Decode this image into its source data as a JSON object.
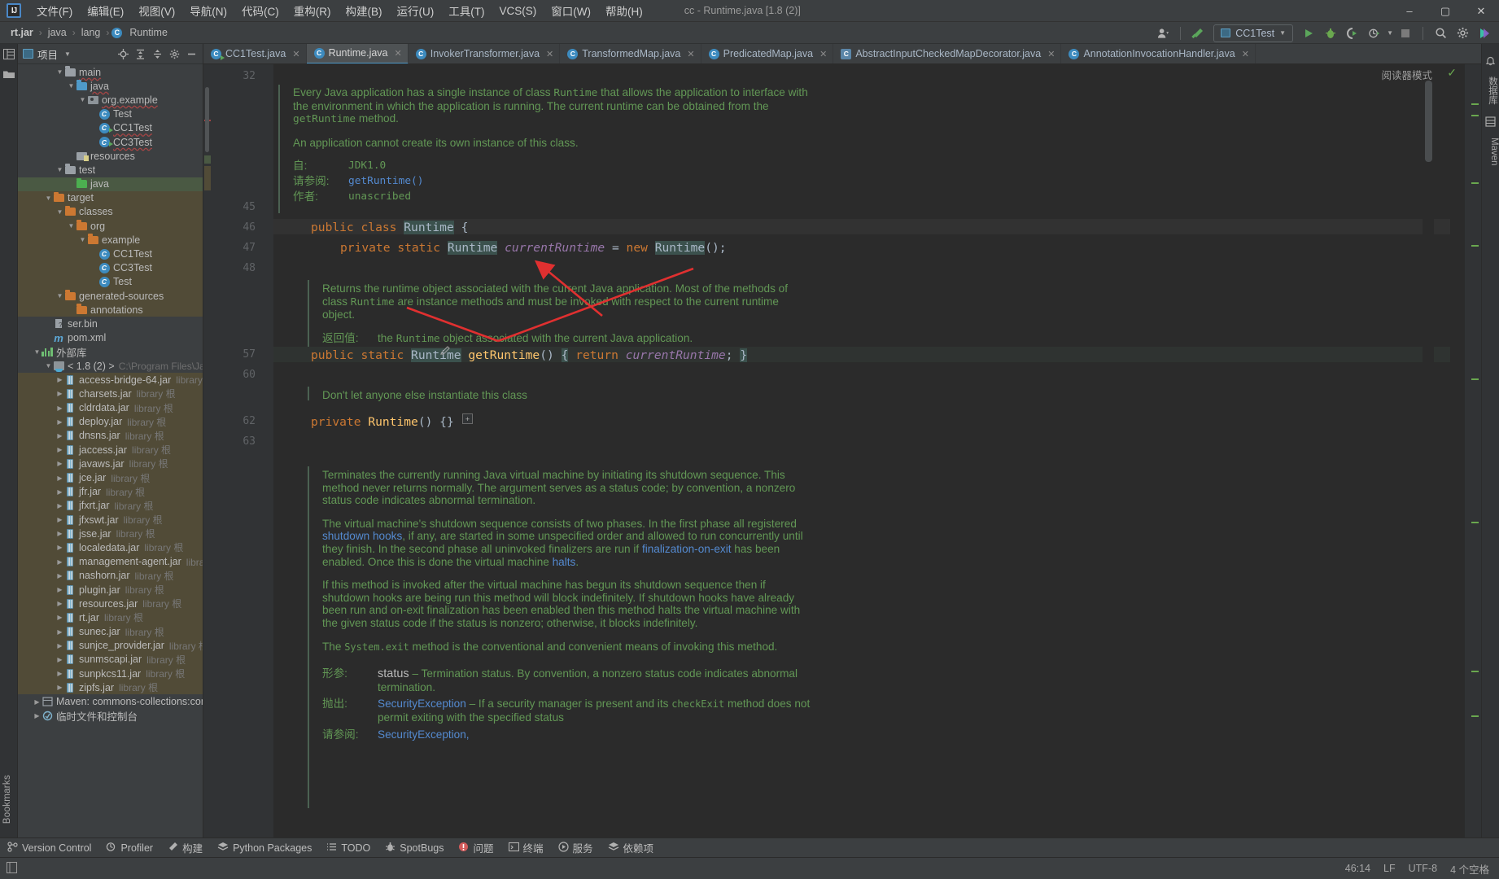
{
  "window": {
    "title": "cc - Runtime.java [1.8 (2)]",
    "minimize": "–",
    "maximize": "▢",
    "close": "✕"
  },
  "menu": {
    "logo": "IJ",
    "items": [
      "文件(F)",
      "编辑(E)",
      "视图(V)",
      "导航(N)",
      "代码(C)",
      "重构(R)",
      "构建(B)",
      "运行(U)",
      "工具(T)",
      "VCS(S)",
      "窗口(W)",
      "帮助(H)"
    ]
  },
  "breadcrumb": {
    "jar": "rt.jar",
    "pkg1": "java",
    "pkg2": "lang",
    "cls": "Runtime",
    "cls_icon_letter": "C",
    "sep": "›"
  },
  "nav_toolbar": {
    "run_config": "CC1Test",
    "icons": [
      "user-icon",
      "hammer-icon",
      "run-icon",
      "debug-icon",
      "run-coverage-icon",
      "profiler-icon",
      "stop-icon",
      "search-icon",
      "settings-icon",
      "ai-icon"
    ]
  },
  "project_panel": {
    "title": "项目",
    "header_icons": [
      "locate-icon",
      "expand-all-icon",
      "collapse-all-icon",
      "settings-icon",
      "hide-icon"
    ],
    "tree": [
      {
        "indent": 3,
        "arrow": "v",
        "icon": "folder-gray",
        "name": "main",
        "meta": "",
        "wavy": true,
        "hl": "none"
      },
      {
        "indent": 4,
        "arrow": "v",
        "icon": "folder-blue",
        "name": "java",
        "meta": "",
        "wavy": true,
        "hl": "none"
      },
      {
        "indent": 5,
        "arrow": "v",
        "icon": "package",
        "name": "org.example",
        "meta": "",
        "wavy": true,
        "hl": "none"
      },
      {
        "indent": 6,
        "arrow": "",
        "icon": "class",
        "name": "Test",
        "meta": "",
        "wavy": false,
        "hl": "none"
      },
      {
        "indent": 6,
        "arrow": "",
        "icon": "class-run",
        "name": "CC1Test",
        "meta": "",
        "wavy": true,
        "hl": "none"
      },
      {
        "indent": 6,
        "arrow": "",
        "icon": "class-run",
        "name": "CC3Test",
        "meta": "",
        "wavy": true,
        "hl": "none"
      },
      {
        "indent": 4,
        "arrow": "",
        "icon": "folder-res",
        "name": "resources",
        "meta": "",
        "wavy": false,
        "hl": "none"
      },
      {
        "indent": 3,
        "arrow": "v",
        "icon": "folder-gray",
        "name": "test",
        "meta": "",
        "wavy": false,
        "hl": "none"
      },
      {
        "indent": 4,
        "arrow": "",
        "icon": "folder-green",
        "name": "java",
        "meta": "",
        "wavy": false,
        "hl": "green"
      },
      {
        "indent": 2,
        "arrow": "v",
        "icon": "folder-orange",
        "name": "target",
        "meta": "",
        "wavy": false,
        "hl": "target"
      },
      {
        "indent": 3,
        "arrow": "v",
        "icon": "folder-orange",
        "name": "classes",
        "meta": "",
        "wavy": false,
        "hl": "target"
      },
      {
        "indent": 4,
        "arrow": "v",
        "icon": "folder-orange",
        "name": "org",
        "meta": "",
        "wavy": false,
        "hl": "target"
      },
      {
        "indent": 5,
        "arrow": "v",
        "icon": "folder-orange",
        "name": "example",
        "meta": "",
        "wavy": false,
        "hl": "target"
      },
      {
        "indent": 6,
        "arrow": "",
        "icon": "class",
        "name": "CC1Test",
        "meta": "",
        "wavy": false,
        "hl": "target"
      },
      {
        "indent": 6,
        "arrow": "",
        "icon": "class",
        "name": "CC3Test",
        "meta": "",
        "wavy": false,
        "hl": "target"
      },
      {
        "indent": 6,
        "arrow": "",
        "icon": "class",
        "name": "Test",
        "meta": "",
        "wavy": false,
        "hl": "target"
      },
      {
        "indent": 3,
        "arrow": "v",
        "icon": "folder-orange",
        "name": "generated-sources",
        "meta": "",
        "wavy": false,
        "hl": "target"
      },
      {
        "indent": 4,
        "arrow": "",
        "icon": "folder-orange",
        "name": "annotations",
        "meta": "",
        "wavy": false,
        "hl": "target"
      },
      {
        "indent": 2,
        "arrow": "",
        "icon": "bin",
        "name": "ser.bin",
        "meta": "",
        "wavy": false,
        "hl": "none"
      },
      {
        "indent": 2,
        "arrow": "",
        "icon": "maven",
        "name": "pom.xml",
        "meta": "",
        "wavy": false,
        "hl": "none"
      },
      {
        "indent": 1,
        "arrow": "v",
        "icon": "library",
        "name": "外部库",
        "meta": "",
        "wavy": false,
        "hl": "none"
      },
      {
        "indent": 2,
        "arrow": "v",
        "icon": "sdk",
        "name": "< 1.8 (2) >",
        "meta": "",
        "path": "C:\\Program Files\\Java\\jdk",
        "wavy": false,
        "hl": "none"
      },
      {
        "indent": 3,
        "arrow": ">",
        "icon": "jar",
        "name": "access-bridge-64.jar",
        "meta": "library 根",
        "wavy": false,
        "hl": "jar"
      },
      {
        "indent": 3,
        "arrow": ">",
        "icon": "jar",
        "name": "charsets.jar",
        "meta": "library 根",
        "wavy": false,
        "hl": "jar"
      },
      {
        "indent": 3,
        "arrow": ">",
        "icon": "jar",
        "name": "cldrdata.jar",
        "meta": "library 根",
        "wavy": false,
        "hl": "jar"
      },
      {
        "indent": 3,
        "arrow": ">",
        "icon": "jar",
        "name": "deploy.jar",
        "meta": "library 根",
        "wavy": false,
        "hl": "jar"
      },
      {
        "indent": 3,
        "arrow": ">",
        "icon": "jar",
        "name": "dnsns.jar",
        "meta": "library 根",
        "wavy": false,
        "hl": "jar"
      },
      {
        "indent": 3,
        "arrow": ">",
        "icon": "jar",
        "name": "jaccess.jar",
        "meta": "library 根",
        "wavy": false,
        "hl": "jar"
      },
      {
        "indent": 3,
        "arrow": ">",
        "icon": "jar",
        "name": "javaws.jar",
        "meta": "library 根",
        "wavy": false,
        "hl": "jar"
      },
      {
        "indent": 3,
        "arrow": ">",
        "icon": "jar",
        "name": "jce.jar",
        "meta": "library 根",
        "wavy": false,
        "hl": "jar"
      },
      {
        "indent": 3,
        "arrow": ">",
        "icon": "jar",
        "name": "jfr.jar",
        "meta": "library 根",
        "wavy": false,
        "hl": "jar"
      },
      {
        "indent": 3,
        "arrow": ">",
        "icon": "jar",
        "name": "jfxrt.jar",
        "meta": "library 根",
        "wavy": false,
        "hl": "jar"
      },
      {
        "indent": 3,
        "arrow": ">",
        "icon": "jar",
        "name": "jfxswt.jar",
        "meta": "library 根",
        "wavy": false,
        "hl": "jar"
      },
      {
        "indent": 3,
        "arrow": ">",
        "icon": "jar",
        "name": "jsse.jar",
        "meta": "library 根",
        "wavy": false,
        "hl": "jar"
      },
      {
        "indent": 3,
        "arrow": ">",
        "icon": "jar",
        "name": "localedata.jar",
        "meta": "library 根",
        "wavy": false,
        "hl": "jar"
      },
      {
        "indent": 3,
        "arrow": ">",
        "icon": "jar",
        "name": "management-agent.jar",
        "meta": "library 根",
        "wavy": false,
        "hl": "jar"
      },
      {
        "indent": 3,
        "arrow": ">",
        "icon": "jar",
        "name": "nashorn.jar",
        "meta": "library 根",
        "wavy": false,
        "hl": "jar"
      },
      {
        "indent": 3,
        "arrow": ">",
        "icon": "jar",
        "name": "plugin.jar",
        "meta": "library 根",
        "wavy": false,
        "hl": "jar"
      },
      {
        "indent": 3,
        "arrow": ">",
        "icon": "jar",
        "name": "resources.jar",
        "meta": "library 根",
        "wavy": false,
        "hl": "jar"
      },
      {
        "indent": 3,
        "arrow": ">",
        "icon": "jar",
        "name": "rt.jar",
        "meta": "library 根",
        "wavy": false,
        "hl": "jar"
      },
      {
        "indent": 3,
        "arrow": ">",
        "icon": "jar",
        "name": "sunec.jar",
        "meta": "library 根",
        "wavy": false,
        "hl": "jar"
      },
      {
        "indent": 3,
        "arrow": ">",
        "icon": "jar",
        "name": "sunjce_provider.jar",
        "meta": "library 根",
        "wavy": false,
        "hl": "jar"
      },
      {
        "indent": 3,
        "arrow": ">",
        "icon": "jar",
        "name": "sunmscapi.jar",
        "meta": "library 根",
        "wavy": false,
        "hl": "jar"
      },
      {
        "indent": 3,
        "arrow": ">",
        "icon": "jar",
        "name": "sunpkcs11.jar",
        "meta": "library 根",
        "wavy": false,
        "hl": "jar"
      },
      {
        "indent": 3,
        "arrow": ">",
        "icon": "jar",
        "name": "zipfs.jar",
        "meta": "library 根",
        "wavy": false,
        "hl": "jar"
      },
      {
        "indent": 1,
        "arrow": ">",
        "icon": "maven-lib",
        "name": "Maven: commons-collections:commo",
        "meta": "",
        "wavy": false,
        "hl": "none"
      },
      {
        "indent": 1,
        "arrow": ">",
        "icon": "scratch",
        "name": "临时文件和控制台",
        "meta": "",
        "wavy": false,
        "hl": "none"
      }
    ]
  },
  "left_rail": {
    "icons": [
      "project-icon",
      "folder-icon"
    ],
    "bookmarks": "Bookmarks"
  },
  "right_rail": {
    "items": [
      "数据库",
      "Maven"
    ],
    "icons": [
      "notifications-icon",
      "database-icon",
      "maven-icon"
    ]
  },
  "editor_tabs": [
    {
      "label": "CC1Test.java",
      "icon": "class-run-icon",
      "active": false,
      "close": "✕"
    },
    {
      "label": "Runtime.java",
      "icon": "class-icon",
      "active": true,
      "close": "✕"
    },
    {
      "label": "InvokerTransformer.java",
      "icon": "class-icon",
      "active": false,
      "close": "✕"
    },
    {
      "label": "TransformedMap.java",
      "icon": "class-icon",
      "active": false,
      "close": "✕"
    },
    {
      "label": "PredicatedMap.java",
      "icon": "class-icon",
      "active": false,
      "close": "✕"
    },
    {
      "label": "AbstractInputCheckedMapDecorator.java",
      "icon": "class-abstract-icon",
      "active": false,
      "close": "✕"
    },
    {
      "label": "AnnotationInvocationHandler.java",
      "icon": "class-icon",
      "active": false,
      "close": "✕"
    }
  ],
  "editor": {
    "reader_mode": "阅读器模式",
    "check_icon": "✓",
    "gutter_lines": [
      "32",
      "45",
      "46",
      "47",
      "48",
      "57",
      "60",
      "62",
      "63"
    ],
    "fold_marker": "+",
    "doc1": {
      "p1_a": "Every Java application has a single instance of class ",
      "p1_code1": "Runtime",
      "p1_b": " that allows the application to interface with",
      "p1_c": "the environment in which the application is running. The current runtime can be obtained from the",
      "p1_code2": "getRuntime",
      "p1_d": " method.",
      "p2": "An application cannot create its own instance of this class.",
      "since_label": "自:",
      "since_value": "JDK1.0",
      "see_label": "请参阅:",
      "see_value": "getRuntime()",
      "author_label": "作者:",
      "author_value": "unascribed"
    },
    "code_line_46": {
      "kw1": "public",
      "kw2": "class",
      "cls": "Runtime",
      "brace": "{"
    },
    "code_line_47": {
      "kw1": "private",
      "kw2": "static",
      "type": "Runtime",
      "field": "currentRuntime",
      "eq": "=",
      "kw3": "new",
      "ctor": "Runtime",
      "rest": "();"
    },
    "doc2": {
      "p1_a": "Returns the runtime object associated with the current Java application. Most of the methods of",
      "p1_b": "class ",
      "p1_code": "Runtime",
      "p1_c": " are instance methods and must be invoked with respect to the current runtime",
      "p1_d": "object.",
      "ret_label": "返回值:",
      "ret_a": "the ",
      "ret_code": "Runtime",
      "ret_b": " object associated with the current Java application."
    },
    "code_line_57": {
      "kw1": "public",
      "kw2": "static",
      "type": "Runtime",
      "mth": "getRuntime",
      "par": "()",
      "brace1": "{",
      "kw3": "return",
      "field": "currentRuntime",
      "semi": ";",
      "brace2": "}"
    },
    "doc3": {
      "text": "Don't let anyone else instantiate this class"
    },
    "code_line_62": {
      "kw1": "private",
      "ctor": "Runtime",
      "rest": "() {}"
    },
    "doc4": {
      "p1_l1": "Terminates the currently running Java virtual machine by initiating its shutdown sequence. This",
      "p1_l2": "method never returns normally. The argument serves as a status code; by convention, a nonzero",
      "p1_l3": "status code indicates abnormal termination.",
      "p2_l1": "The virtual machine's shutdown sequence consists of two phases. In the first phase all registered",
      "p2_l2_a": "shutdown hooks",
      "p2_l2_b": ", if any, are started in some unspecified order and allowed to run concurrently until",
      "p2_l3_a": "they finish. In the second phase all uninvoked finalizers are run if ",
      "p2_l3_b": "finalization-on-exit",
      "p2_l3_c": " has been",
      "p2_l4_a": "enabled. Once this is done the virtual machine ",
      "p2_l4_b": "halts",
      "p2_l4_c": ".",
      "p3_l1": "If this method is invoked after the virtual machine has begun its shutdown sequence then if",
      "p3_l2": "shutdown hooks are being run this method will block indefinitely. If shutdown hooks have already",
      "p3_l3": "been run and on-exit finalization has been enabled then this method halts the virtual machine with",
      "p3_l4": "the given status code if the status is nonzero; otherwise, it blocks indefinitely.",
      "p4_a": "The ",
      "p4_code": "System.exit",
      "p4_b": " method is the conventional and convenient means of invoking this method.",
      "param_label": "形参:",
      "param_name": "status",
      "param_dash": "– Termination status. By convention, a nonzero status code indicates abnormal",
      "param_cont": "termination.",
      "throws_label": "抛出:",
      "throws_name": "SecurityException",
      "throws_dash_a": "– If a security manager is present and its ",
      "throws_code": "checkExit",
      "throws_dash_b": " method does not",
      "throws_cont": "permit exiting with the specified status",
      "see_label": "请参阅:",
      "see_value": "SecurityException,"
    }
  },
  "bottom_bar": [
    {
      "label": "Version Control",
      "icon": "branch-icon"
    },
    {
      "label": "Profiler",
      "icon": "profiler-icon"
    },
    {
      "label": "构建",
      "icon": "hammer-icon"
    },
    {
      "label": "Python Packages",
      "icon": "packages-icon"
    },
    {
      "label": "TODO",
      "icon": "list-icon"
    },
    {
      "label": "SpotBugs",
      "icon": "bug-icon"
    },
    {
      "label": "问题",
      "icon": "error-icon"
    },
    {
      "label": "终端",
      "icon": "terminal-icon"
    },
    {
      "label": "服务",
      "icon": "services-icon"
    },
    {
      "label": "依赖项",
      "icon": "dependencies-icon"
    }
  ],
  "status_bar": {
    "left_icon": "layout-icon",
    "caret": "46:14",
    "line_sep": "LF",
    "encoding": "UTF-8",
    "indent": "4 个空格"
  },
  "colors": {
    "accent_blue": "#4f9ac9",
    "doc_green": "#629755",
    "keyword_orange": "#cc7832",
    "field_purple": "#9876aa",
    "method_yellow": "#ffc66d",
    "arrow_red": "#e03030",
    "editor_bg": "#2b2b2b",
    "panel_bg": "#3c3f41"
  }
}
